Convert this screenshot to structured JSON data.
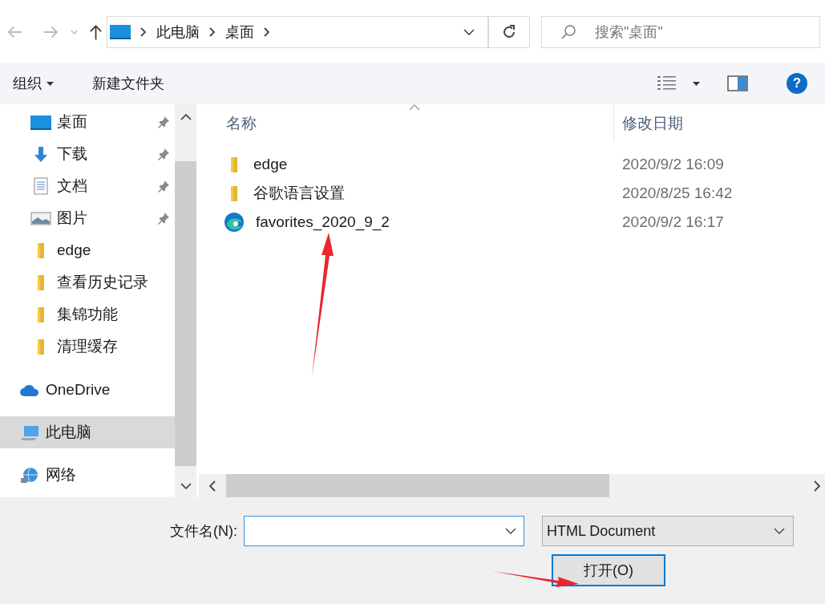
{
  "address_bar": {
    "crumbs": [
      "此电脑",
      "桌面"
    ]
  },
  "search": {
    "placeholder": "搜索\"桌面\""
  },
  "toolbar": {
    "organize": "组织",
    "new_folder": "新建文件夹"
  },
  "sidebar": {
    "items": [
      {
        "label": "桌面",
        "kind": "desktop",
        "pinned": true,
        "selected": false
      },
      {
        "label": "下载",
        "kind": "download",
        "pinned": true,
        "selected": false
      },
      {
        "label": "文档",
        "kind": "document",
        "pinned": true,
        "selected": false
      },
      {
        "label": "图片",
        "kind": "picture",
        "pinned": true,
        "selected": false
      },
      {
        "label": "edge",
        "kind": "folder",
        "pinned": false,
        "selected": false
      },
      {
        "label": "查看历史记录",
        "kind": "folder",
        "pinned": false,
        "selected": false
      },
      {
        "label": "集锦功能",
        "kind": "folder",
        "pinned": false,
        "selected": false
      },
      {
        "label": "清理缓存",
        "kind": "folder",
        "pinned": false,
        "selected": false
      },
      {
        "label": "OneDrive",
        "kind": "cloud",
        "pinned": false,
        "selected": false
      },
      {
        "label": "此电脑",
        "kind": "computer",
        "pinned": false,
        "selected": true
      },
      {
        "label": "网络",
        "kind": "network",
        "pinned": false,
        "selected": false
      }
    ]
  },
  "file_list": {
    "columns": [
      "名称",
      "修改日期"
    ],
    "rows": [
      {
        "name": "edge",
        "date": "2020/9/2 16:09",
        "kind": "folder"
      },
      {
        "name": "谷歌语言设置",
        "date": "2020/8/25 16:42",
        "kind": "folder"
      },
      {
        "name": "favorites_2020_9_2",
        "date": "2020/9/2 16:17",
        "kind": "edge-file"
      }
    ]
  },
  "help": {
    "glyph": "?"
  },
  "footer": {
    "filename_label": "文件名(N):",
    "file_type": "HTML Document",
    "open_button": "打开(O)"
  }
}
